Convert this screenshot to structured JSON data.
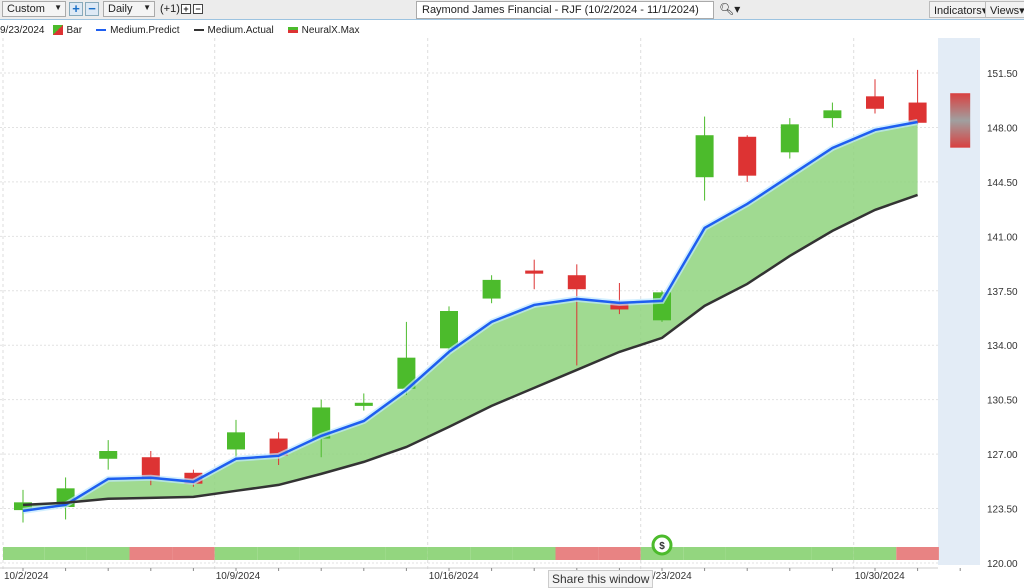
{
  "toolbar": {
    "period": "Custom",
    "interval": "Daily",
    "offset": "(+1)",
    "title": "Raymond James Financial - RJF (10/2/2024 - 11/1/2024)",
    "indicators": "Indicators",
    "views": "Views"
  },
  "legend": {
    "date": "9/23/2024",
    "items": [
      "Bar",
      "Medium.Predict",
      "Medium.Actual",
      "NeuralX.Max"
    ]
  },
  "share_tooltip": "Share this window",
  "colors": {
    "up": "#4cbb2c",
    "down": "#dd3333",
    "predict": "#1e5ef0",
    "actual": "#333333",
    "fill": "#8fd47e",
    "signal_up": "#93d67f",
    "signal_down": "#e88383"
  },
  "chart_data": {
    "type": "candlestick",
    "title": "Raymond James Financial - RJF (10/2/2024 - 11/1/2024)",
    "ylim": [
      120,
      151.5
    ],
    "yticks": [
      "151.50",
      "148.00",
      "144.50",
      "141.00",
      "137.50",
      "134.00",
      "130.50",
      "127.00",
      "123.50",
      "120.00"
    ],
    "xticks": [
      {
        "label": "10/2/2024",
        "index": -0.5
      },
      {
        "label": "10/9/2024",
        "index": 4.5
      },
      {
        "label": "10/16/2024",
        "index": 9.5
      },
      {
        "label": "10/23/2024",
        "index": 14.5
      },
      {
        "label": "10/30/2024",
        "index": 19.5
      }
    ],
    "ohlc": [
      [
        123.4,
        124.7,
        122.6,
        123.9
      ],
      [
        123.6,
        125.5,
        122.8,
        124.8
      ],
      [
        126.7,
        127.9,
        126.0,
        127.2
      ],
      [
        126.8,
        127.2,
        125.0,
        125.5
      ],
      [
        125.8,
        126.0,
        124.9,
        125.1
      ],
      [
        127.3,
        129.2,
        126.8,
        128.4
      ],
      [
        128.0,
        128.4,
        126.3,
        126.9
      ],
      [
        128.0,
        130.5,
        126.8,
        130.0
      ],
      [
        130.1,
        130.9,
        129.8,
        130.3
      ],
      [
        131.2,
        135.5,
        130.8,
        133.2
      ],
      [
        133.8,
        136.5,
        133.4,
        136.2
      ],
      [
        137.0,
        138.5,
        136.7,
        138.2
      ],
      [
        138.8,
        139.5,
        137.6,
        138.6
      ],
      [
        138.5,
        139.2,
        132.7,
        137.6
      ],
      [
        136.7,
        138.0,
        136.0,
        136.3
      ],
      [
        135.6,
        137.5,
        135.5,
        137.4
      ],
      [
        144.8,
        148.7,
        143.3,
        147.5
      ],
      [
        147.4,
        147.5,
        144.5,
        144.9
      ],
      [
        146.4,
        148.6,
        146.0,
        148.2
      ],
      [
        148.6,
        149.6,
        148.0,
        149.1
      ],
      [
        150.0,
        151.1,
        148.9,
        149.2
      ],
      [
        149.6,
        151.7,
        148.2,
        148.3
      ]
    ],
    "forecast_range": [
      146.7,
      150.2
    ],
    "series": [
      {
        "name": "Medium.Predict",
        "values": [
          123.35,
          123.74,
          125.41,
          125.48,
          125.22,
          126.7,
          126.89,
          128.17,
          129.13,
          131.13,
          133.57,
          135.5,
          136.59,
          136.98,
          136.72,
          136.85,
          141.54,
          143.08,
          144.88,
          146.68,
          147.84,
          148.35
        ]
      },
      {
        "name": "Medium.Actual",
        "values": [
          123.74,
          123.87,
          124.13,
          124.19,
          124.25,
          124.64,
          125.02,
          125.73,
          126.5,
          127.46,
          128.75,
          130.1,
          131.26,
          132.41,
          133.57,
          134.47,
          136.53,
          137.94,
          139.74,
          141.35,
          142.7,
          143.66
        ]
      }
    ],
    "signals": [
      1,
      1,
      1,
      0,
      0,
      1,
      1,
      1,
      1,
      1,
      1,
      1,
      1,
      0,
      0,
      1,
      1,
      1,
      1,
      1,
      1,
      0
    ]
  }
}
